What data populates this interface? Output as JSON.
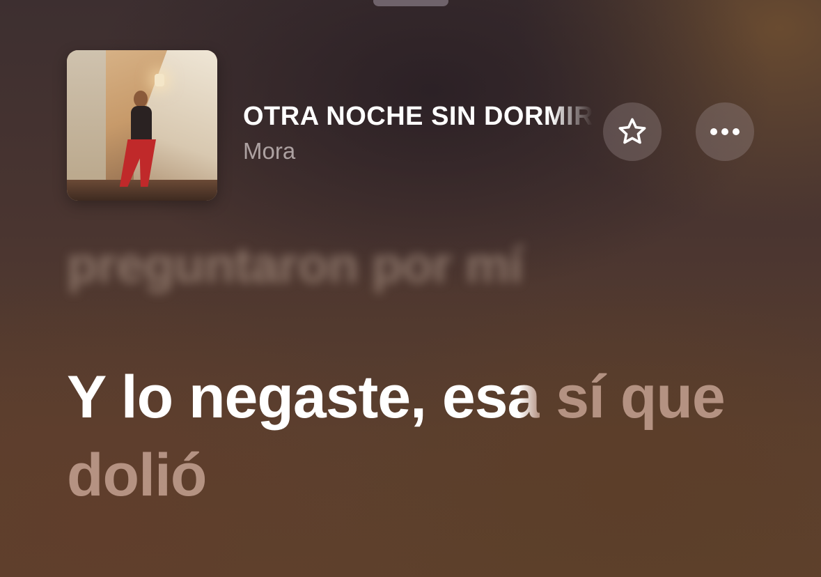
{
  "song": {
    "title": "OTRA NOCHE SIN DORMIR",
    "artist": "Mora"
  },
  "buttons": {
    "favorite_icon": "star-icon",
    "more_icon": "ellipsis-icon"
  },
  "lyrics": {
    "previous_line": "preguntaron por mí",
    "current_line": {
      "sung_part": "Y lo negaste, es",
      "fading_part": "a",
      "unsung_part": " sí que dolió"
    }
  }
}
